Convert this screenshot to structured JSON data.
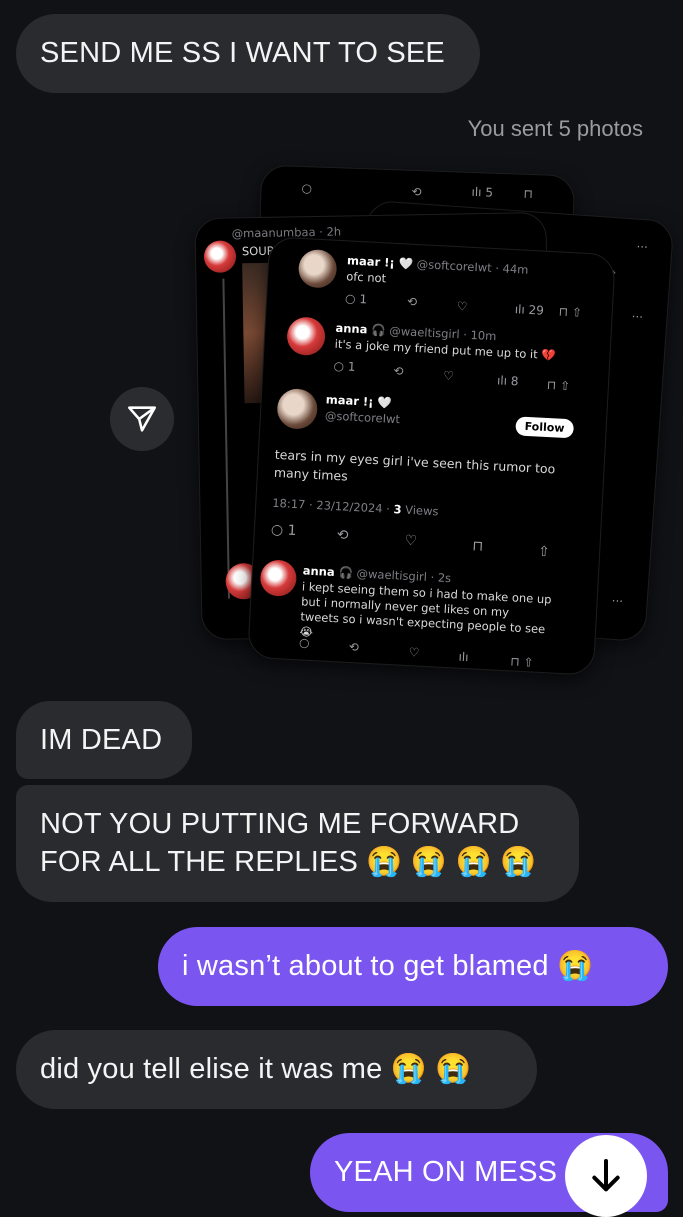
{
  "messages": [
    {
      "text": "SEND ME SS I WANT TO SEE"
    },
    {
      "text": "IM DEAD"
    },
    {
      "text": "NOT YOU PUTTING ME FORWARD FOR ALL THE REPLIES 😭 😭 😭 😭"
    },
    {
      "text": "i wasn’t about to get blamed 😭"
    },
    {
      "text": "did you tell elise it was me 😭 😭"
    },
    {
      "text": "YEAH ON MESS"
    }
  ],
  "photos_meta": "You sent 5 photos",
  "screenshot": {
    "top_user": "@maanumbaa · 2h",
    "source_text": "SOURCE??",
    "t1_name": "maar !¡ 🤍",
    "t1_handle": "@softcoreIwt · 44m",
    "t1_text": "ofc not",
    "t1_views": "29",
    "t2_name": "anna 🎧",
    "t2_handle": "@waeltisgirl · 10m",
    "t2_text": "it's a joke my friend put me up to it 💔",
    "t2_views": "8",
    "t3_name": "maar !¡ 🤍",
    "t3_handle": "@softcoreIwt",
    "follow_label": "Follow",
    "t3_text": "tears in my eyes girl i've seen this rumor too many times",
    "t3_date": "18:17 · 23/12/2024 ·",
    "t3_views_count": "3",
    "t3_views_label": "Views",
    "t3_replies": "1",
    "t4_name": "anna 🎧",
    "t4_handle": "@waeltisgirl · 2s",
    "t4_text": "i kept seeing them so i had to make one up but i normally never get likes on my tweets so i wasn't expecting people to see 😭",
    "back_views": "5",
    "reply_count_small": "1"
  },
  "colors": {
    "background": "#111216",
    "received_bubble": "#2a2b2f",
    "sent_bubble": "#7b55f0"
  },
  "icons": [
    "send-share-icon",
    "arrow-down-icon"
  ]
}
